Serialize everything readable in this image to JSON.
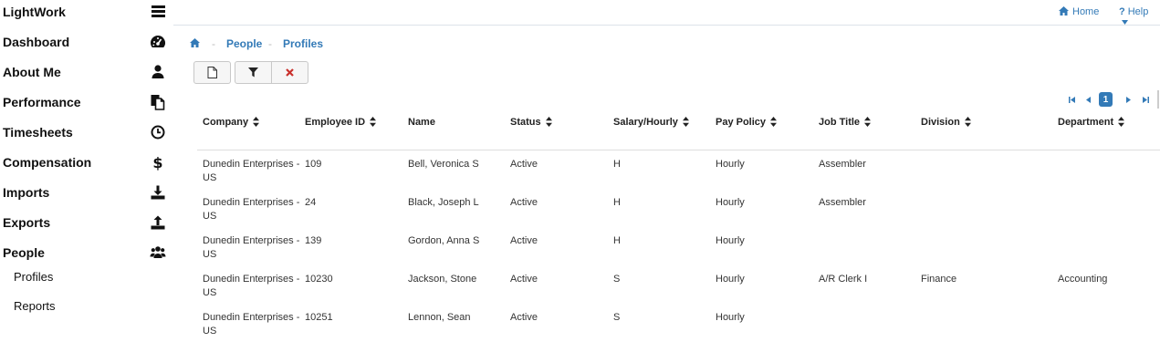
{
  "app": {
    "brand": "LightWork"
  },
  "sidebar": {
    "items": [
      {
        "label": "Dashboard",
        "icon": "dashboard-icon"
      },
      {
        "label": "About Me",
        "icon": "user-icon"
      },
      {
        "label": "Performance",
        "icon": "documents-icon"
      },
      {
        "label": "Timesheets",
        "icon": "clock-icon"
      },
      {
        "label": "Compensation",
        "icon": "dollar-icon"
      },
      {
        "label": "Imports",
        "icon": "download-icon"
      },
      {
        "label": "Exports",
        "icon": "upload-icon"
      },
      {
        "label": "People",
        "icon": "users-icon"
      }
    ],
    "subitems": [
      {
        "label": "Profiles"
      },
      {
        "label": "Reports"
      }
    ]
  },
  "topbar": {
    "home_label": "Home",
    "help_label": "Help"
  },
  "breadcrumb": {
    "items": [
      "People",
      "Profiles"
    ],
    "separator": "-"
  },
  "toolbar": {
    "buttons": [
      "new-document",
      "filter",
      "clear-filter"
    ]
  },
  "pagination": {
    "current_page": "1"
  },
  "colors": {
    "link": "#337ab7",
    "clear": "#c9302c",
    "accent": "#337ab7"
  },
  "table": {
    "columns": [
      "Company",
      "Employee ID",
      "Name",
      "Status",
      "Salary/Hourly",
      "Pay Policy",
      "Job Title",
      "Division",
      "Department"
    ],
    "rows": [
      [
        "Dunedin Enterprises - US",
        "109",
        "Bell, Veronica S",
        "Active",
        "H",
        "Hourly",
        "Assembler",
        "",
        ""
      ],
      [
        "Dunedin Enterprises - US",
        "24",
        "Black, Joseph L",
        "Active",
        "H",
        "Hourly",
        "Assembler",
        "",
        ""
      ],
      [
        "Dunedin Enterprises - US",
        "139",
        "Gordon, Anna S",
        "Active",
        "H",
        "Hourly",
        "",
        "",
        ""
      ],
      [
        "Dunedin Enterprises - US",
        "10230",
        "Jackson, Stone",
        "Active",
        "S",
        "Hourly",
        "A/R Clerk I",
        "Finance",
        "Accounting"
      ],
      [
        "Dunedin Enterprises - US",
        "10251",
        "Lennon, Sean",
        "Active",
        "S",
        "Hourly",
        "",
        "",
        ""
      ]
    ]
  }
}
